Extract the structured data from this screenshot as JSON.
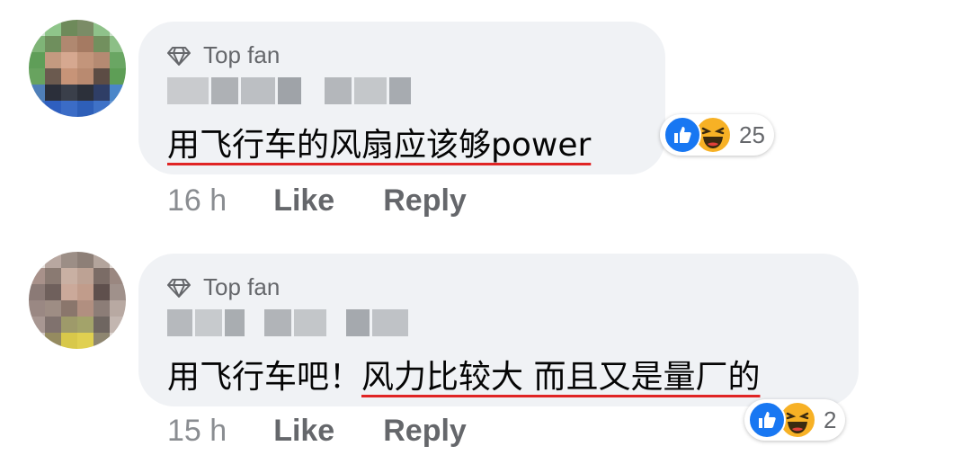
{
  "comments": [
    {
      "badge": "Top fan",
      "text_plain": "",
      "text_underlined": "用飞行车的风扇应该够power",
      "reaction_count": "25",
      "time": "16 h",
      "like_label": "Like",
      "reply_label": "Reply"
    },
    {
      "badge": "Top fan",
      "text_plain": "用飞行车吧！",
      "text_underlined": "风力比较大 而且又是量厂的",
      "reaction_count": "2",
      "time": "15 h",
      "like_label": "Like",
      "reply_label": "Reply"
    }
  ],
  "colors": {
    "bubble": "#f0f2f5",
    "like_blue": "#1877f2",
    "haha_yellow": "#f7b125",
    "underline_red": "#e02424",
    "muted_text": "#65676b"
  },
  "icons": [
    "diamond-icon",
    "like-reaction-icon",
    "haha-reaction-icon",
    "avatar"
  ]
}
